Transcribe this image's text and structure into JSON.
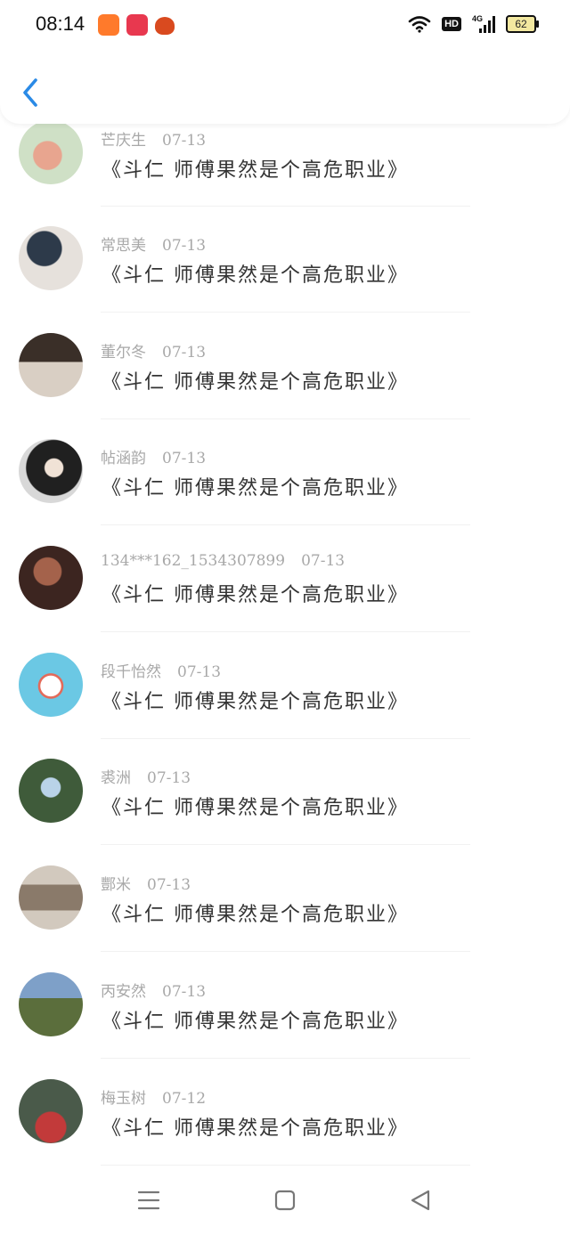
{
  "status_bar": {
    "time": "08:14",
    "hd": "HD",
    "network": "4G",
    "battery": "62"
  },
  "header": {
    "back_icon": "chevron-left-icon",
    "accent": "#2a8ae6"
  },
  "list": [
    {
      "name": "芒庆生",
      "date": "07-13",
      "content": "《斗仁 师傅果然是个高危职业》",
      "avatar_colors": [
        "#cfe0c6",
        "#e8a58f"
      ]
    },
    {
      "name": "常思美",
      "date": "07-13",
      "content": "《斗仁 师傅果然是个高危职业》",
      "avatar_colors": [
        "#2d3a4a",
        "#e6e1dc"
      ]
    },
    {
      "name": "董尔冬",
      "date": "07-13",
      "content": "《斗仁 师傅果然是个高危职业》",
      "avatar_colors": [
        "#3a2f28",
        "#d9cfc4"
      ]
    },
    {
      "name": "帖涵韵",
      "date": "07-13",
      "content": "《斗仁 师傅果然是个高危职业》",
      "avatar_colors": [
        "#202020",
        "#d8d8d8"
      ]
    },
    {
      "name": "134***162_1534307899",
      "date": "07-13",
      "content": "《斗仁 师傅果然是个高危职业》",
      "avatar_colors": [
        "#3c2520",
        "#a4624b"
      ]
    },
    {
      "name": "段千怡然",
      "date": "07-13",
      "content": "《斗仁 师傅果然是个高危职业》",
      "avatar_colors": [
        "#6bc8e4",
        "#ffffff"
      ]
    },
    {
      "name": "裘洲",
      "date": "07-13",
      "content": "《斗仁 师傅果然是个高危职业》",
      "avatar_colors": [
        "#3f5b3a",
        "#b9d3e8"
      ]
    },
    {
      "name": "酆米",
      "date": "07-13",
      "content": "《斗仁 师傅果然是个高危职业》",
      "avatar_colors": [
        "#8a7a6a",
        "#d2c9be"
      ]
    },
    {
      "name": "丙安然",
      "date": "07-13",
      "content": "《斗仁 师傅果然是个高危职业》",
      "avatar_colors": [
        "#7ea0c8",
        "#5b6e3c"
      ]
    },
    {
      "name": "梅玉树",
      "date": "07-12",
      "content": "《斗仁 师傅果然是个高危职业》",
      "avatar_colors": [
        "#4a5a4a",
        "#c23a3a"
      ]
    }
  ],
  "navbar": {
    "menu_icon": "menu-icon",
    "home_icon": "home-square-icon",
    "back_icon": "back-triangle-icon"
  }
}
